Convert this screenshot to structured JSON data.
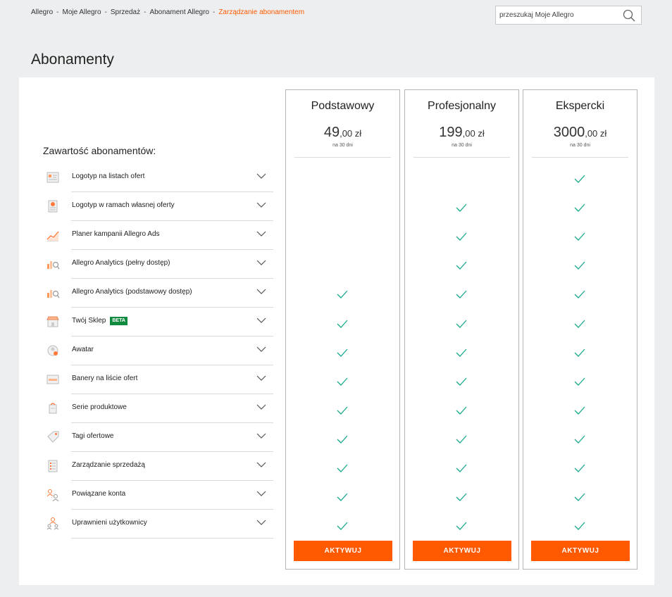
{
  "breadcrumb": {
    "items": [
      "Allegro",
      "Moje Allegro",
      "Sprzedaż",
      "Abonament Allegro"
    ],
    "current": "Zarządzanie abonamentem",
    "separator": "-"
  },
  "search": {
    "placeholder": "przeszukaj Moje Allegro",
    "icon": "search-icon"
  },
  "page_title": "Abonamenty",
  "features_title": "Zawartość abonamentów:",
  "features": [
    {
      "label": "Logotyp na listach ofert",
      "icon": "list-logo-icon"
    },
    {
      "label": "Logotyp w ramach własnej oferty",
      "icon": "offer-logo-icon"
    },
    {
      "label": "Planer kampanii Allegro Ads",
      "icon": "campaign-chart-icon"
    },
    {
      "label": "Allegro Analytics (pełny dostęp)",
      "icon": "analytics-icon"
    },
    {
      "label": "Allegro Analytics (podstawowy dostęp)",
      "icon": "analytics-basic-icon"
    },
    {
      "label": "Twój Sklep",
      "icon": "shop-icon",
      "badge": "BETA"
    },
    {
      "label": "Awatar",
      "icon": "avatar-icon"
    },
    {
      "label": "Banery na liście ofert",
      "icon": "banner-icon"
    },
    {
      "label": "Serie produktowe",
      "icon": "product-series-icon"
    },
    {
      "label": "Tagi ofertowe",
      "icon": "tag-icon"
    },
    {
      "label": "Zarządzanie sprzedażą",
      "icon": "sales-management-icon"
    },
    {
      "label": "Powiązane konta",
      "icon": "linked-accounts-icon"
    },
    {
      "label": "Uprawnieni użytkownicy",
      "icon": "users-icon"
    }
  ],
  "plans": [
    {
      "name": "Podstawowy",
      "price_main": "49",
      "price_cents": ",00 zł",
      "period": "na 30 dni",
      "button": "AKTYWUJ",
      "included": [
        false,
        false,
        false,
        false,
        true,
        true,
        true,
        true,
        true,
        true,
        true,
        true,
        true
      ]
    },
    {
      "name": "Profesjonalny",
      "price_main": "199",
      "price_cents": ",00 zł",
      "period": "na 30 dni",
      "button": "AKTYWUJ",
      "included": [
        false,
        true,
        true,
        true,
        true,
        true,
        true,
        true,
        true,
        true,
        true,
        true,
        true
      ]
    },
    {
      "name": "Ekspercki",
      "price_main": "3000",
      "price_cents": ",00 zł",
      "period": "na 30 dni",
      "button": "AKTYWUJ",
      "included": [
        true,
        true,
        true,
        true,
        true,
        true,
        true,
        true,
        true,
        true,
        true,
        true,
        true
      ]
    }
  ],
  "colors": {
    "accent": "#ff5a00",
    "check": "#1aaa8d",
    "badge": "#108a3e"
  }
}
